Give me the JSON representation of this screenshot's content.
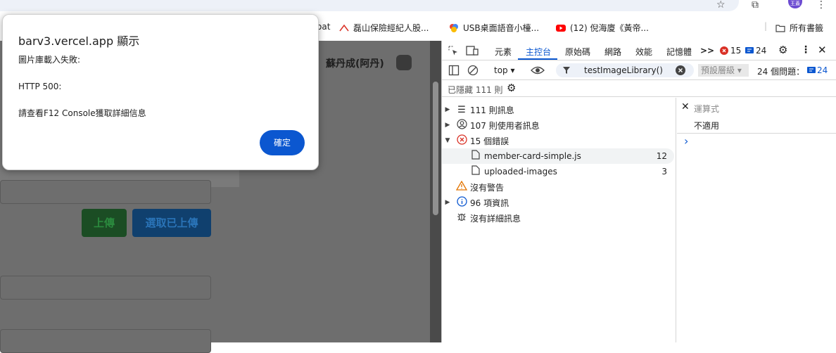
{
  "browser": {
    "bookmarks": [
      {
        "label": "oat"
      },
      {
        "label": "磊山保險經紀人股..."
      },
      {
        "label": "USB桌面語音小檯..."
      },
      {
        "label": "(12) 倪海廈《黃帝..."
      }
    ],
    "all_bookmarks": "所有書籤",
    "avatar_text": "王蓋"
  },
  "page": {
    "user_name": "蘇丹成(阿丹)",
    "upload_button": "上傳",
    "select_uploaded_button": "選取已上傳"
  },
  "dialog": {
    "title": "barv3.vercel.app 顯示",
    "message": "圖片庫載入失敗:\n\nHTTP 500:\n\n請查看F12 Console獲取詳細信息",
    "ok_button": "確定"
  },
  "devtools": {
    "tabs": [
      "元素",
      "主控台",
      "原始碼",
      "網路",
      "效能",
      "記憶體"
    ],
    "active_tab": "主控台",
    "more": ">>",
    "error_count": "15",
    "message_count": "24",
    "context": "top",
    "filter_text": "testImageLibrary()",
    "levels_label": "預設層級",
    "issues_label": "24 個問題：",
    "issues_count": "24",
    "hidden_label": "已隱藏 111 則",
    "sidebar": [
      {
        "label": "111 則訊息",
        "icon": "list-icon",
        "arrow": "▶"
      },
      {
        "label": "107 則使用者訊息",
        "icon": "user-icon",
        "arrow": "▶"
      },
      {
        "label": "15 個錯誤",
        "icon": "error-icon",
        "arrow": "▼"
      },
      {
        "label": "member-card-simple.js",
        "icon": "file-icon",
        "count": "12"
      },
      {
        "label": "uploaded-images",
        "icon": "file-icon",
        "count": "3"
      },
      {
        "label": "沒有警告",
        "icon": "warning-icon"
      },
      {
        "label": "96 項資訊",
        "icon": "info-icon",
        "arrow": "▶"
      },
      {
        "label": "沒有詳細訊息",
        "icon": "bug-icon"
      }
    ],
    "expression_label": "運算式",
    "expression_value": "不適用",
    "prompt": "›"
  },
  "colors": {
    "accent": "#0b57d0",
    "error": "#d93025",
    "warning": "#e37400"
  }
}
